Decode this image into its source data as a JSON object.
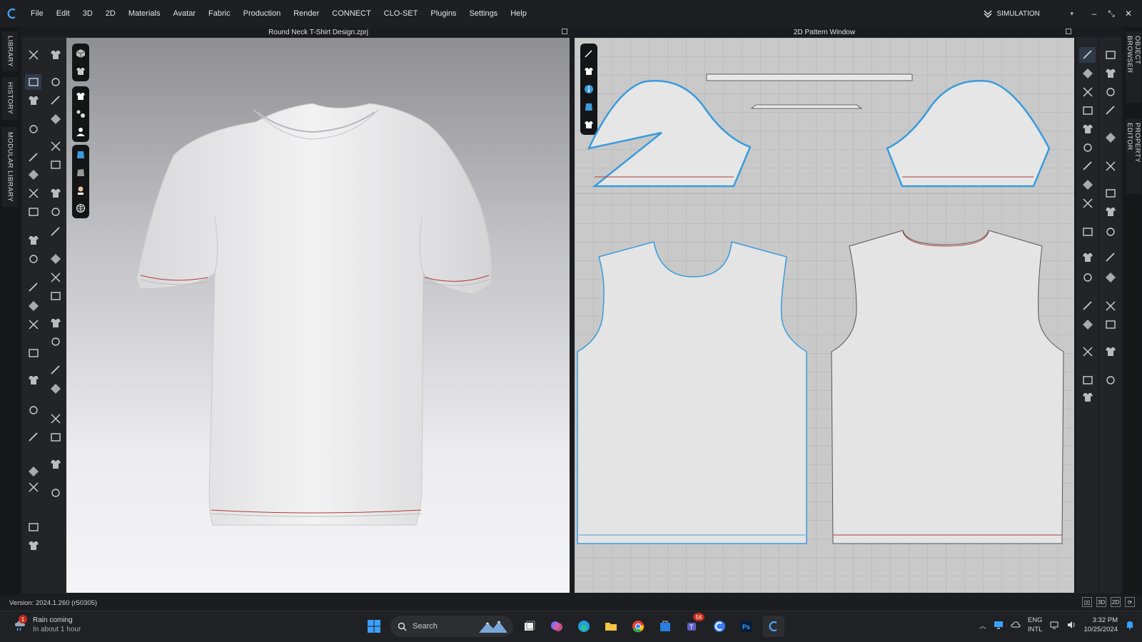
{
  "menu": {
    "items": [
      "File",
      "Edit",
      "3D",
      "2D",
      "Materials",
      "Avatar",
      "Fabric",
      "Production",
      "Render",
      "CONNECT",
      "CLO-SET",
      "Plugins",
      "Settings",
      "Help"
    ],
    "mode_label": "SIMULATION",
    "mode_caret": "▾",
    "minimize": "–",
    "restore": "⤡",
    "close": "✕"
  },
  "left_tabs": [
    "LIBRARY",
    "HISTORY",
    "MODULAR LIBRARY"
  ],
  "right_tabs": [
    "OBJECT BROWSER",
    "PROPERTY EDITOR"
  ],
  "window_3d": {
    "title": "Round Neck T-Shirt Design.zprj"
  },
  "window_2d": {
    "title": "2D Pattern Window"
  },
  "status": {
    "version": "Version: 2024.1.260 (r50305)",
    "view_buttons": [
      "▯▯",
      "3D",
      "2D",
      "⟳"
    ]
  },
  "taskbar": {
    "weather_title": "Rain coming",
    "weather_sub": "In about 1 hour",
    "weather_badge": "1",
    "search_placeholder": "Search",
    "teams_badge": "56",
    "lang_top": "ENG",
    "lang_bottom": "INTL",
    "time": "3:32 PM",
    "date": "10/25/2024"
  },
  "colors": {
    "accent": "#3a9bdc",
    "seam_red": "#b03a3a",
    "bg_dark": "#1b1c1f"
  }
}
